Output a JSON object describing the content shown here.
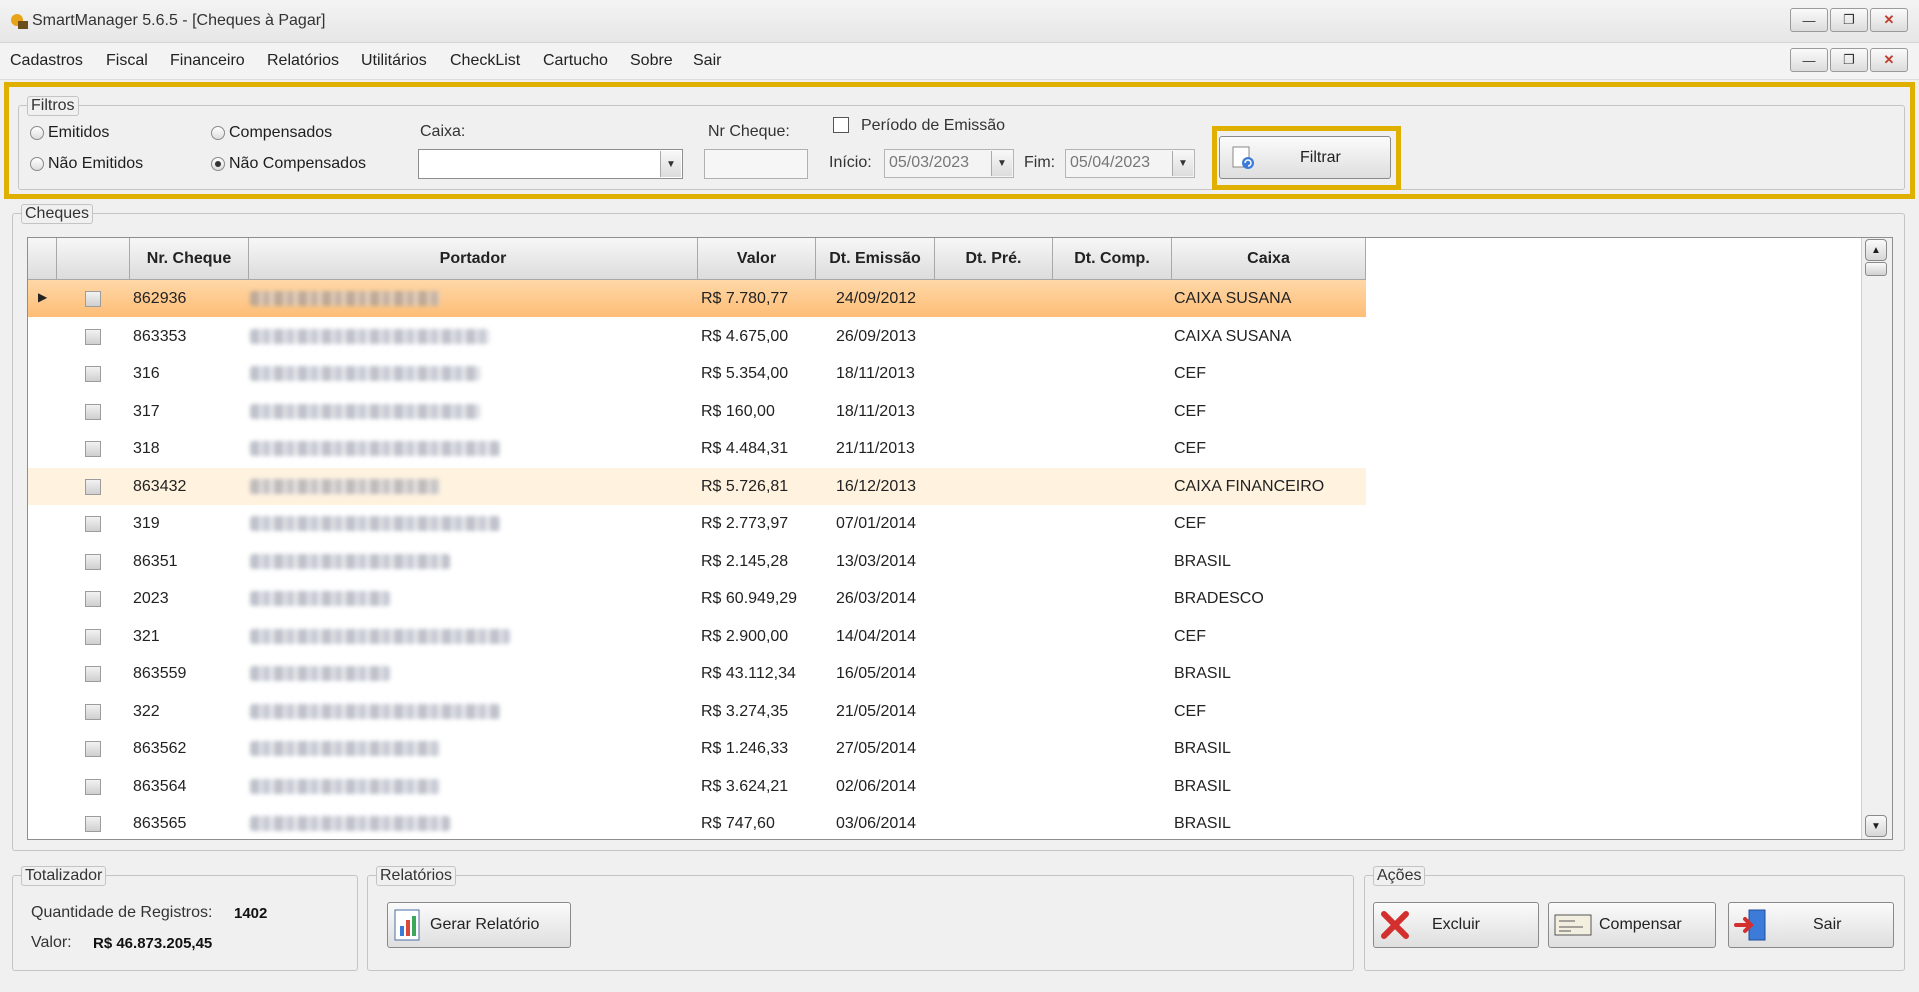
{
  "window": {
    "title": "SmartManager 5.6.5 - [Cheques à Pagar]"
  },
  "menu": [
    "Cadastros",
    "Fiscal",
    "Financeiro",
    "Relatórios",
    "Utilitários",
    "CheckList",
    "Cartucho",
    "Sobre",
    "Sair"
  ],
  "filters": {
    "legend": "Filtros",
    "emitidos": "Emitidos",
    "nao_emitidos": "Não Emitidos",
    "compensados": "Compensados",
    "nao_compensados": "Não Compensados",
    "caixa_label": "Caixa:",
    "caixa_value": "",
    "nr_cheque_label": "Nr Cheque:",
    "nr_cheque_value": "",
    "periodo_label": "Período de Emissão",
    "inicio_label": "Início:",
    "inicio_value": "05/03/2023",
    "fim_label": "Fim:",
    "fim_value": "05/04/2023",
    "filtrar": "Filtrar"
  },
  "cheques": {
    "legend": "Cheques",
    "columns": [
      "Nr. Cheque",
      "Portador",
      "Valor",
      "Dt. Emissão",
      "Dt. Pré.",
      "Dt. Comp.",
      "Caixa"
    ],
    "rows": [
      {
        "nr": "862936",
        "valor": "R$ 7.780,77",
        "emissao": "24/09/2012",
        "caixa": "CAIXA SUSANA"
      },
      {
        "nr": "863353",
        "valor": "R$ 4.675,00",
        "emissao": "26/09/2013",
        "caixa": "CAIXA SUSANA"
      },
      {
        "nr": "316",
        "valor": "R$ 5.354,00",
        "emissao": "18/11/2013",
        "caixa": "CEF"
      },
      {
        "nr": "317",
        "valor": "R$ 160,00",
        "emissao": "18/11/2013",
        "caixa": "CEF"
      },
      {
        "nr": "318",
        "valor": "R$ 4.484,31",
        "emissao": "21/11/2013",
        "caixa": "CEF"
      },
      {
        "nr": "863432",
        "valor": "R$ 5.726,81",
        "emissao": "16/12/2013",
        "caixa": "CAIXA FINANCEIRO"
      },
      {
        "nr": "319",
        "valor": "R$ 2.773,97",
        "emissao": "07/01/2014",
        "caixa": "CEF"
      },
      {
        "nr": "86351",
        "valor": "R$ 2.145,28",
        "emissao": "13/03/2014",
        "caixa": "BRASIL"
      },
      {
        "nr": "2023",
        "valor": "R$ 60.949,29",
        "emissao": "26/03/2014",
        "caixa": "BRADESCO"
      },
      {
        "nr": "321",
        "valor": "R$ 2.900,00",
        "emissao": "14/04/2014",
        "caixa": "CEF"
      },
      {
        "nr": "863559",
        "valor": "R$ 43.112,34",
        "emissao": "16/05/2014",
        "caixa": "BRASIL"
      },
      {
        "nr": "322",
        "valor": "R$ 3.274,35",
        "emissao": "21/05/2014",
        "caixa": "CEF"
      },
      {
        "nr": "863562",
        "valor": "R$ 1.246,33",
        "emissao": "27/05/2014",
        "caixa": "BRASIL"
      },
      {
        "nr": "863564",
        "valor": "R$ 3.624,21",
        "emissao": "02/06/2014",
        "caixa": "BRASIL"
      },
      {
        "nr": "863565",
        "valor": "R$ 747,60",
        "emissao": "03/06/2014",
        "caixa": "BRASIL"
      }
    ]
  },
  "totalizador": {
    "legend": "Totalizador",
    "qtd_label": "Quantidade de Registros:",
    "qtd_value": "1402",
    "valor_label": "Valor:",
    "valor_value": "R$ 46.873.205,45"
  },
  "relatorios": {
    "legend": "Relatórios",
    "gerar": "Gerar Relatório"
  },
  "acoes": {
    "legend": "Ações",
    "excluir": "Excluir",
    "compensar": "Compensar",
    "sair": "Sair"
  }
}
